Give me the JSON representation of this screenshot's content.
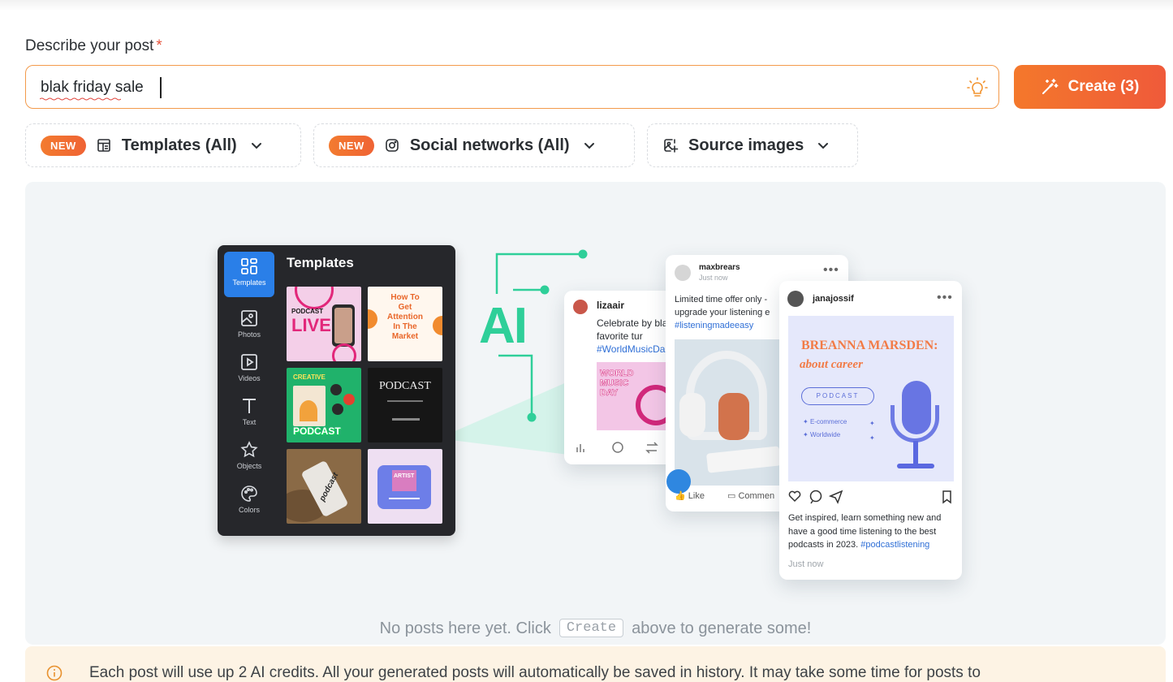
{
  "form": {
    "label": "Describe your post",
    "required_mark": "*",
    "prompt_value": "blak friday sale",
    "suggest_icon": "lightbulb-icon"
  },
  "create_button": {
    "label": "Create (3)",
    "icon": "magic-wand-icon"
  },
  "filters": [
    {
      "badge": "NEW",
      "icon": "template-icon",
      "label": "Templates (All)"
    },
    {
      "badge": "NEW",
      "icon": "instagram-icon",
      "label": "Social networks (All)"
    },
    {
      "badge": "",
      "icon": "image-plus-icon",
      "label": "Source images"
    }
  ],
  "illustration": {
    "editor_title": "Templates",
    "sidebar": [
      "Templates",
      "Photos",
      "Videos",
      "Text",
      "Objects",
      "Colors"
    ],
    "templates": [
      {
        "lines": [
          "PODCAST",
          "LIVE"
        ]
      },
      {
        "lines": [
          "How To",
          "Get",
          "Attention",
          "In The",
          "Market"
        ]
      },
      {
        "lines": [
          "CREATIVE",
          "PODCAST"
        ]
      },
      {
        "lines": [
          "PODCAST"
        ]
      },
      {
        "lines": [
          "podcast"
        ]
      },
      {
        "lines": [
          "ARTIST"
        ]
      }
    ],
    "ai_label": "AI",
    "posts": [
      {
        "user": "lizaair",
        "text": "Celebrate by bla your favorite tur",
        "tag": "#WorldMusicDa",
        "image_text": "WORLD MUSIC DAY"
      },
      {
        "user": "maxbrears",
        "sub": "Just now",
        "text": "Limited time offer only - upgrade your listening e",
        "tag": "#listeningmadeeasy",
        "actions": [
          "Like",
          "Commen"
        ]
      },
      {
        "user": "janajossif",
        "image_title": "BREANNA MARSDEN:",
        "image_subtitle": "about career",
        "image_pill": "PODCAST",
        "image_list": [
          "E-commerce",
          "Worldwide"
        ],
        "caption": "Get inspired, learn something new and have a good time listening to the best podcasts in 2023.",
        "tag": "#podcastlistening",
        "time": "Just now"
      }
    ]
  },
  "empty_state": {
    "before": "No posts here yet. Click",
    "key": "Create",
    "after": "above to generate some!"
  },
  "notice": {
    "icon": "info-icon",
    "text": "Each post will use up 2 AI credits. All your generated posts will automatically be saved in history. It may take some time for posts to"
  },
  "colors": {
    "accent": "#f4782b",
    "ai_green": "#2fcf99",
    "highlight": "#2a7fe8"
  }
}
